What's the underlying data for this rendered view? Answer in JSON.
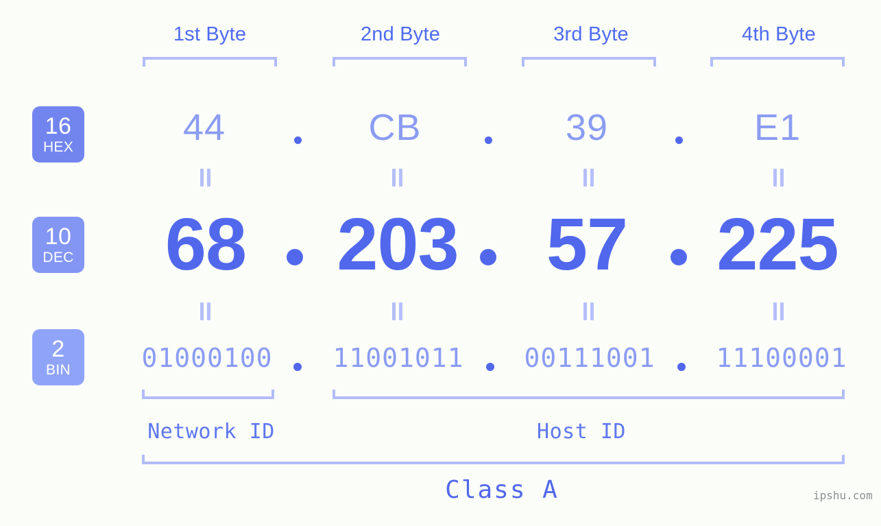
{
  "diagram": {
    "ip_address": "68.203.57.225",
    "class_label": "Class A",
    "watermark": "ipshu.com",
    "byte_headers": [
      {
        "label": "1st Byte"
      },
      {
        "label": "2nd Byte"
      },
      {
        "label": "3rd Byte"
      },
      {
        "label": "4th Byte"
      }
    ],
    "rows": [
      {
        "base_number": "16",
        "base_name": "HEX",
        "values": [
          "44",
          "CB",
          "39",
          "E1"
        ]
      },
      {
        "base_number": "10",
        "base_name": "DEC",
        "values": [
          "68",
          "203",
          "57",
          "225"
        ]
      },
      {
        "base_number": "2",
        "base_name": "BIN",
        "values": [
          "01000100",
          "11001011",
          "00111001",
          "11100001"
        ]
      }
    ],
    "separators": {
      "dot": "."
    },
    "equals_symbol": "=",
    "id_spans": [
      {
        "label": "Network ID"
      },
      {
        "label": "Host ID"
      }
    ],
    "colors": {
      "background": "#fbfdf9",
      "accent_strong": "#5168ec",
      "accent_light": "#8b9cf2",
      "bracket": "#b3bcf9",
      "badge_hex": "#7285ef",
      "badge_dec": "#8396f4",
      "badge_bin": "#8fa4f8",
      "watermark": "#8f8f8f"
    }
  }
}
